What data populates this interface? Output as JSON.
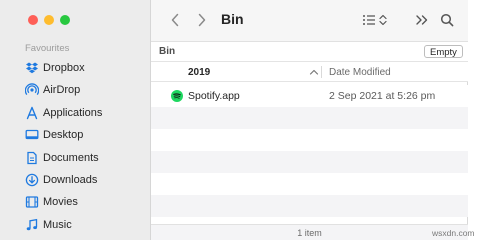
{
  "colors": {
    "accent": "#1f7ae0",
    "spotify_green": "#1ed760"
  },
  "sidebar": {
    "section_label": "Favourites",
    "items": [
      {
        "label": "Dropbox",
        "icon": "dropbox-icon"
      },
      {
        "label": "AirDrop",
        "icon": "airdrop-icon"
      },
      {
        "label": "Applications",
        "icon": "applications-icon"
      },
      {
        "label": "Desktop",
        "icon": "desktop-icon"
      },
      {
        "label": "Documents",
        "icon": "documents-icon"
      },
      {
        "label": "Downloads",
        "icon": "downloads-icon"
      },
      {
        "label": "Movies",
        "icon": "movies-icon"
      },
      {
        "label": "Music",
        "icon": "music-icon"
      }
    ]
  },
  "toolbar": {
    "title": "Bin"
  },
  "pathbar": {
    "label": "Bin",
    "empty_button": "Empty"
  },
  "columns": {
    "name": "2019",
    "date": "Date Modified"
  },
  "files": [
    {
      "name": "Spotify.app",
      "date": "2 Sep 2021 at 5:26 pm",
      "icon": "spotify-icon"
    }
  ],
  "status": {
    "text": "1 item"
  },
  "watermark": "wsxdn.com"
}
